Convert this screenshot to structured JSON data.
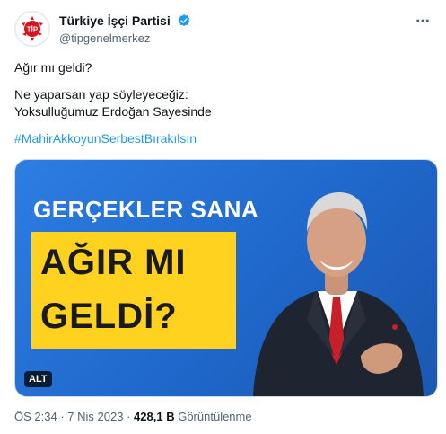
{
  "account": {
    "display_name": "Türkiye İşçi Partisi",
    "handle": "@tipgenelmerkez",
    "avatar_text": "TİP",
    "verified": true
  },
  "tweet": {
    "line1": "Ağır mı geldi?",
    "line2": "Ne yaparsan yap söyleyeceğiz:",
    "line3": "Yoksulluğumuz Erdoğan Sayesinde",
    "hashtag": "#MahirAkkoyunSerbestBırakılsın"
  },
  "media": {
    "banner_line1": "GERÇEKLER SANA",
    "banner_line2": "AĞIR MI",
    "banner_line3": "GELDİ?",
    "alt_label": "ALT"
  },
  "meta": {
    "time": "ÖS 2:34",
    "separator": "·",
    "date": "7 Nis 2023",
    "views_count": "428,1 B",
    "views_label": "Görüntülenme"
  },
  "colors": {
    "accent": "#1d9bf0",
    "banner_blue": "#2d7de3",
    "banner_yellow": "#ffd21f",
    "party_red": "#d7141f"
  }
}
